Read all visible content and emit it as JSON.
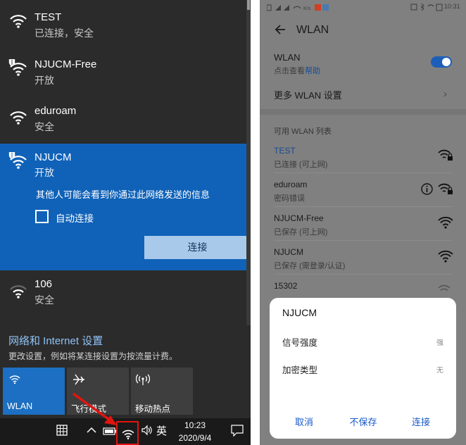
{
  "windows": {
    "networks": [
      {
        "name": "TEST",
        "status": "已连接，安全",
        "secured": false
      },
      {
        "name": "NJUCM-Free",
        "status": "开放",
        "secured": true
      },
      {
        "name": "eduroam",
        "status": "安全",
        "secured": false
      },
      {
        "name": "NJUCM",
        "status": "开放",
        "secured": true,
        "selected": true
      },
      {
        "name": "106",
        "status": "安全",
        "secured": false
      }
    ],
    "selected_network": {
      "warning": "其他人可能会看到你通过此网络发送的信息",
      "auto_connect_label": "自动连接",
      "auto_connect_checked": false,
      "connect_button": "连接"
    },
    "settings_link": "网络和 Internet 设置",
    "settings_desc": "更改设置，例如将某连接设置为按流量计费。",
    "quick_tiles": [
      {
        "label": "WLAN",
        "icon": "wifi-icon",
        "active": true
      },
      {
        "label": "飞行模式",
        "icon": "airplane-icon",
        "active": false
      },
      {
        "label": "移动热点",
        "icon": "hotspot-icon",
        "active": false
      }
    ],
    "taskbar": {
      "ime": "英",
      "time": "10:23",
      "date": "2020/9/4"
    },
    "colors": {
      "accent": "#1062b8",
      "highlight": "#e0150e"
    }
  },
  "android": {
    "status_time": "10:31",
    "title": "WLAN",
    "wlan_label": "WLAN",
    "wlan_sub_prefix": "点击查看",
    "wlan_sub_link": "帮助",
    "wlan_enabled": true,
    "more_settings": "更多 WLAN 设置",
    "list_header": "可用 WLAN 列表",
    "access_points": [
      {
        "name": "TEST",
        "status": "已连接 (可上网)",
        "connected": true,
        "locked": true
      },
      {
        "name": "eduroam",
        "status": "密码错误",
        "locked": true,
        "info": true
      },
      {
        "name": "NJUCM-Free",
        "status": "已保存 (可上网)",
        "locked": false
      },
      {
        "name": "NJUCM",
        "status": "已保存 (需登录/认证)",
        "locked": false
      },
      {
        "name": "15302",
        "status": "",
        "locked": true
      }
    ],
    "dialog": {
      "title": "NJUCM",
      "rows": [
        {
          "key": "信号强度",
          "value": "强"
        },
        {
          "key": "加密类型",
          "value": "无"
        }
      ],
      "buttons": [
        "取消",
        "不保存",
        "连接"
      ]
    },
    "colors": {
      "accent": "#1d5fb8",
      "link": "#114d9a"
    }
  }
}
